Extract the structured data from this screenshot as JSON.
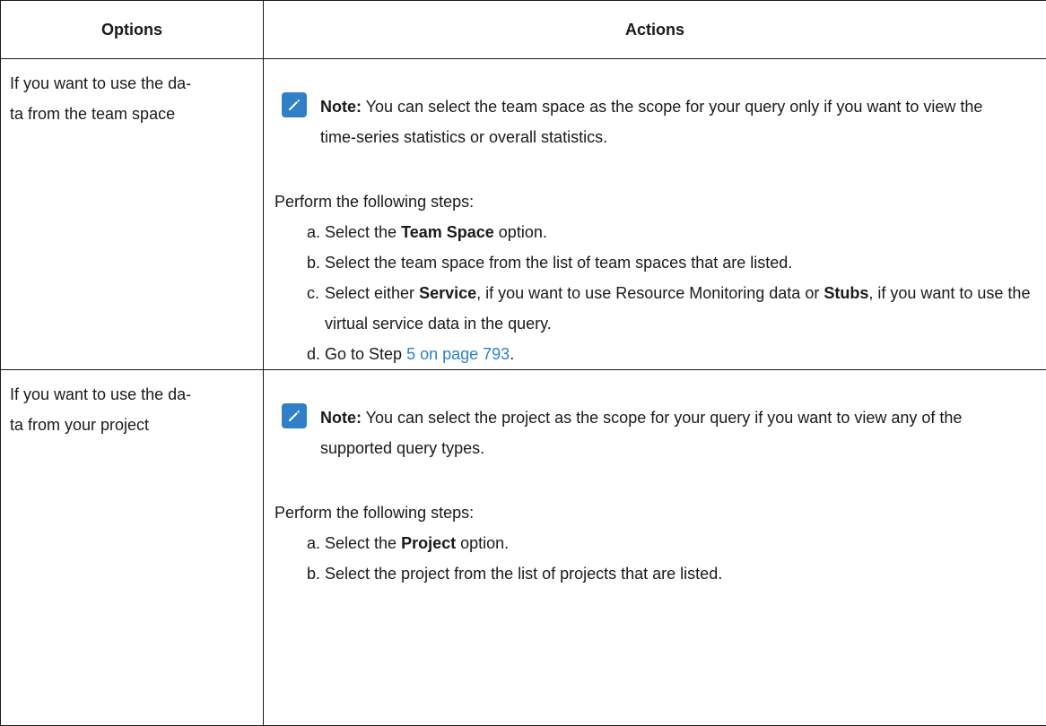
{
  "header": {
    "options": "Options",
    "actions": "Actions"
  },
  "rows": [
    {
      "option_line1": "If you want to use the da-",
      "option_line2": "ta from the team space",
      "note_label": "Note:",
      "note_text": " You can select the team space as the scope for your query only if you want to view the time-series statistics or overall statistics.",
      "perform": "Perform the following steps:",
      "steps": [
        {
          "marker": "a.",
          "pre": "Select the ",
          "bold": "Team Space",
          "post": " option."
        },
        {
          "marker": "b.",
          "pre": "Select the team space from the list of team spaces that are listed."
        },
        {
          "marker": "c.",
          "pre": "Select either ",
          "bold": "Service",
          "post": ", if you want to use Resource Monitoring data or ",
          "bold2": "Stubs",
          "post2": ", if you want to use the virtual service data in the query."
        },
        {
          "marker": "d.",
          "pre": "Go to Step ",
          "link": "5 on page 793",
          "post": "."
        }
      ]
    },
    {
      "option_line1": "If you want to use the da-",
      "option_line2": "ta from your project",
      "note_label": "Note:",
      "note_text": " You can select the project as the scope for your query if you want to view any of the supported query types.",
      "perform": "Perform the following steps:",
      "steps": [
        {
          "marker": "a.",
          "pre": "Select the ",
          "bold": "Project",
          "post": " option."
        },
        {
          "marker": "b.",
          "pre": "Select the project from the list of projects that are listed."
        }
      ]
    }
  ],
  "icons": {
    "note": "pencil-note-icon"
  },
  "colors": {
    "accent": "#2f80c8",
    "text": "#1a1a1a"
  }
}
